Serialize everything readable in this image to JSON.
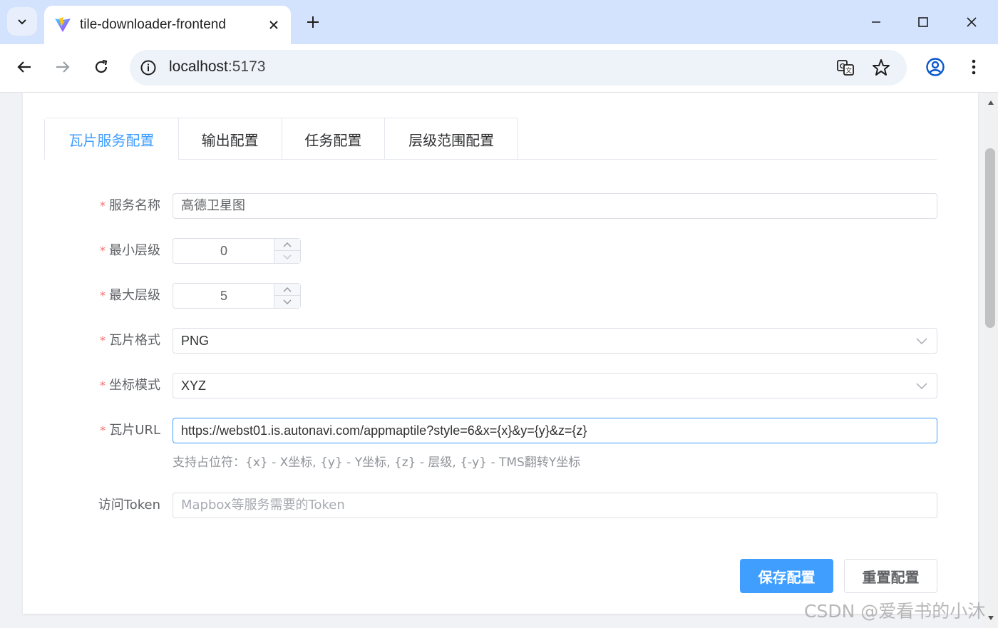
{
  "browser": {
    "tab_title": "tile-downloader-frontend",
    "url_host": "localhost",
    "url_port": ":5173"
  },
  "tabs": [
    {
      "label": "瓦片服务配置",
      "active": true
    },
    {
      "label": "输出配置",
      "active": false
    },
    {
      "label": "任务配置",
      "active": false
    },
    {
      "label": "层级范围配置",
      "active": false
    }
  ],
  "form": {
    "service_name": {
      "label": "服务名称",
      "value": "高德卫星图"
    },
    "min_level": {
      "label": "最小层级",
      "value": "0"
    },
    "max_level": {
      "label": "最大层级",
      "value": "5"
    },
    "tile_format": {
      "label": "瓦片格式",
      "value": "PNG"
    },
    "coord_mode": {
      "label": "坐标模式",
      "value": "XYZ"
    },
    "tile_url": {
      "label": "瓦片URL",
      "value": "https://webst01.is.autonavi.com/appmaptile?style=6&x={x}&y={y}&z={z}",
      "help": "支持占位符：{x} - X坐标, {y} - Y坐标, {z} - 层级, {-y} - TMS翻转Y坐标"
    },
    "token": {
      "label": "访问Token",
      "value": "",
      "placeholder": "Mapbox等服务需要的Token"
    },
    "required_mark": "*"
  },
  "buttons": {
    "save": "保存配置",
    "reset": "重置配置"
  },
  "watermark": "CSDN @爱看书的小沐",
  "colors": {
    "primary": "#409eff",
    "required": "#f56c6c",
    "titlebar": "#d3e3fd"
  }
}
